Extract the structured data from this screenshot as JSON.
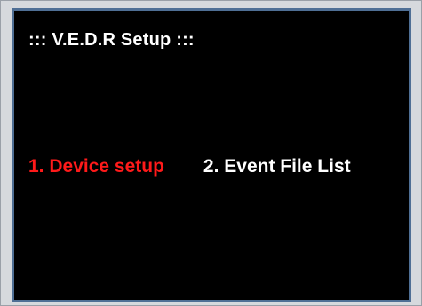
{
  "screen": {
    "title": "::: V.E.D.R Setup :::",
    "menu": [
      {
        "label": "1. Device setup",
        "selected": true,
        "color": "#ff1a1a"
      },
      {
        "label": "2. Event File List",
        "selected": false,
        "color": "#ffffff"
      }
    ]
  },
  "colors": {
    "background": "#000000",
    "border": "#4f6f95",
    "text": "#ffffff",
    "selected_text": "#ff1a1a"
  }
}
